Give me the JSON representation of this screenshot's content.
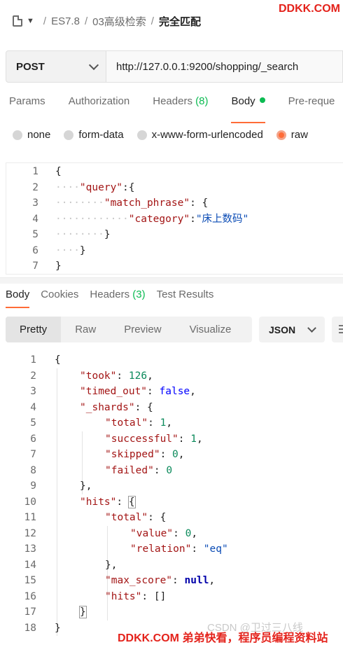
{
  "breadcrumb": {
    "items": [
      "ES7.8",
      "03高级检索",
      "完全匹配"
    ],
    "separator": "/"
  },
  "watermarks": {
    "top": "DDKK.COM",
    "bottom": "DDKK.COM 弟弟快看，程序员编程资料站",
    "csdn": "CSDN @卫过三八线"
  },
  "request": {
    "method": "POST",
    "url": "http://127.0.0.1:9200/shopping/_search"
  },
  "request_tabs": {
    "params": "Params",
    "authorization": "Authorization",
    "headers": "Headers",
    "headers_count": "(8)",
    "body": "Body",
    "pre_request": "Pre-reque"
  },
  "body_types": {
    "none": "none",
    "form_data": "form-data",
    "urlencoded": "x-www-form-urlencoded",
    "raw": "raw"
  },
  "request_body_lines": [
    {
      "n": "1",
      "parts": [
        [
          "p",
          "{"
        ]
      ]
    },
    {
      "n": "2",
      "parts": [
        [
          "w",
          "····"
        ],
        [
          "k",
          "\"query\""
        ],
        [
          "p",
          ":{"
        ]
      ]
    },
    {
      "n": "3",
      "parts": [
        [
          "w",
          "········"
        ],
        [
          "k",
          "\"match_phrase\""
        ],
        [
          "p",
          ": {"
        ]
      ]
    },
    {
      "n": "4",
      "parts": [
        [
          "w",
          "············"
        ],
        [
          "k",
          "\"category\""
        ],
        [
          "p",
          ":"
        ],
        [
          "s",
          "\"床上数码\""
        ]
      ]
    },
    {
      "n": "5",
      "parts": [
        [
          "w",
          "········"
        ],
        [
          "p",
          "}"
        ]
      ]
    },
    {
      "n": "6",
      "parts": [
        [
          "w",
          "····"
        ],
        [
          "p",
          "}"
        ]
      ]
    },
    {
      "n": "7",
      "parts": [
        [
          "p",
          "}"
        ]
      ]
    }
  ],
  "response_tabs": {
    "body": "Body",
    "cookies": "Cookies",
    "headers": "Headers",
    "headers_count": "(3)",
    "test_results": "Test Results"
  },
  "view_modes": {
    "pretty": "Pretty",
    "raw": "Raw",
    "preview": "Preview",
    "visualize": "Visualize"
  },
  "format": "JSON",
  "response_lines": [
    {
      "n": "1",
      "indent": 0,
      "parts": [
        [
          "p",
          "{"
        ]
      ]
    },
    {
      "n": "2",
      "indent": 1,
      "parts": [
        [
          "k",
          "\"took\""
        ],
        [
          "p",
          ": "
        ],
        [
          "num",
          "126"
        ],
        [
          "p",
          ","
        ]
      ]
    },
    {
      "n": "3",
      "indent": 1,
      "parts": [
        [
          "k",
          "\"timed_out\""
        ],
        [
          "p",
          ": "
        ],
        [
          "kw",
          "false"
        ],
        [
          "p",
          ","
        ]
      ]
    },
    {
      "n": "4",
      "indent": 1,
      "parts": [
        [
          "k",
          "\"_shards\""
        ],
        [
          "p",
          ": {"
        ]
      ]
    },
    {
      "n": "5",
      "indent": 2,
      "parts": [
        [
          "k",
          "\"total\""
        ],
        [
          "p",
          ": "
        ],
        [
          "num",
          "1"
        ],
        [
          "p",
          ","
        ]
      ]
    },
    {
      "n": "6",
      "indent": 2,
      "parts": [
        [
          "k",
          "\"successful\""
        ],
        [
          "p",
          ": "
        ],
        [
          "num",
          "1"
        ],
        [
          "p",
          ","
        ]
      ]
    },
    {
      "n": "7",
      "indent": 2,
      "parts": [
        [
          "k",
          "\"skipped\""
        ],
        [
          "p",
          ": "
        ],
        [
          "num",
          "0"
        ],
        [
          "p",
          ","
        ]
      ]
    },
    {
      "n": "8",
      "indent": 2,
      "parts": [
        [
          "k",
          "\"failed\""
        ],
        [
          "p",
          ": "
        ],
        [
          "num",
          "0"
        ]
      ]
    },
    {
      "n": "9",
      "indent": 1,
      "parts": [
        [
          "p",
          "},"
        ]
      ]
    },
    {
      "n": "10",
      "indent": 1,
      "parts": [
        [
          "k",
          "\"hits\""
        ],
        [
          "p",
          ": "
        ],
        [
          "b",
          "{"
        ]
      ]
    },
    {
      "n": "11",
      "indent": 2,
      "parts": [
        [
          "k",
          "\"total\""
        ],
        [
          "p",
          ": {"
        ]
      ]
    },
    {
      "n": "12",
      "indent": 3,
      "parts": [
        [
          "k",
          "\"value\""
        ],
        [
          "p",
          ": "
        ],
        [
          "num",
          "0"
        ],
        [
          "p",
          ","
        ]
      ]
    },
    {
      "n": "13",
      "indent": 3,
      "parts": [
        [
          "k",
          "\"relation\""
        ],
        [
          "p",
          ": "
        ],
        [
          "s",
          "\"eq\""
        ]
      ]
    },
    {
      "n": "14",
      "indent": 2,
      "parts": [
        [
          "p",
          "},"
        ]
      ]
    },
    {
      "n": "15",
      "indent": 2,
      "parts": [
        [
          "k",
          "\"max_score\""
        ],
        [
          "p",
          ": "
        ],
        [
          "nul",
          "null"
        ],
        [
          "p",
          ","
        ]
      ]
    },
    {
      "n": "16",
      "indent": 2,
      "parts": [
        [
          "k",
          "\"hits\""
        ],
        [
          "p",
          ": []"
        ]
      ]
    },
    {
      "n": "17",
      "indent": 1,
      "parts": [
        [
          "b",
          "}"
        ]
      ]
    },
    {
      "n": "18",
      "indent": 0,
      "parts": [
        [
          "p",
          "}"
        ]
      ]
    }
  ],
  "colors": {
    "accent": "#ff6c37",
    "status_green": "#0cbb52",
    "json_key": "#a31515",
    "json_string": "#0a4bb5",
    "json_number": "#0b8a5b",
    "json_boolean": "#0000ff",
    "watermark": "#e4221b"
  }
}
